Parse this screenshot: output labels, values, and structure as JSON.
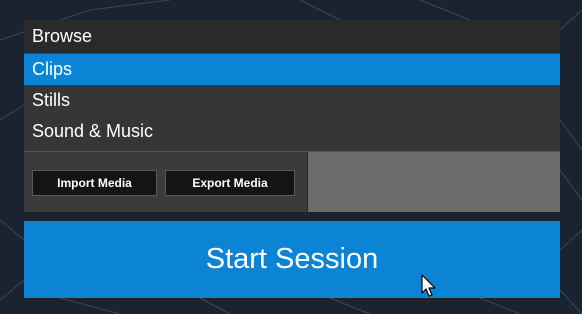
{
  "browse": {
    "title": "Browse",
    "items": [
      {
        "label": "Clips",
        "selected": true
      },
      {
        "label": "Stills",
        "selected": false
      },
      {
        "label": "Sound & Music",
        "selected": false
      }
    ]
  },
  "actions": {
    "import_label": "Import Media",
    "export_label": "Export Media"
  },
  "start": {
    "label": "Start Session"
  },
  "cursor": {
    "icon": "mouse-pointer-icon"
  },
  "colors": {
    "accent": "#0b84d6",
    "panel": "#2e2e2e",
    "button_dark": "#141414"
  }
}
